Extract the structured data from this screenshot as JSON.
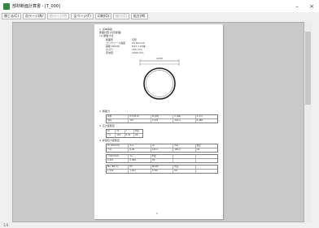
{
  "window": {
    "title": "部材断面計算書 - [T_000]",
    "minimize": "–",
    "close": "×"
  },
  "toolbar": [
    {
      "label": "閉じる(C)",
      "enabled": true
    },
    {
      "label": "次ページ(N)",
      "enabled": true
    },
    {
      "label": "前ページ(P)",
      "enabled": false
    },
    {
      "label": "全ページ(F)",
      "enabled": true
    },
    {
      "label": "印刷(O)",
      "enabled": true
    },
    {
      "label": "縮小(Z)",
      "enabled": false
    },
    {
      "label": "拡大(M)",
      "enabled": true
    }
  ],
  "page": {
    "heading": "1. 基本情報",
    "subheading": "断面計算 (円形断面)",
    "section1": "(1) 断面寸法",
    "params": [
      {
        "k": "断面形",
        "v": "円形"
      },
      {
        "k": "コンクリート強度",
        "v": "24 N/mm2"
      },
      {
        "k": "鉄筋 SD345",
        "v": "D22 x 20本"
      },
      {
        "k": "かぶり",
        "v": "100 mm"
      },
      {
        "k": "有効径",
        "v": "1000 mm"
      }
    ],
    "dim_label": "1200",
    "section2": "2. 断面力",
    "table2": [
      [
        "荷重",
        "M (kN.m)",
        "N (kN)",
        "S (kN)",
        "e (m)"
      ],
      [
        "常時",
        "567",
        "1,234",
        "123.4",
        "0.460"
      ]
    ],
    "section3": "3. 応力度照査",
    "table3": [
      [
        "σc",
        "σs",
        "τ",
        "判定"
      ],
      [
        "7.2",
        "143",
        "0.32",
        "OK"
      ]
    ],
    "section4": "4. 許容応力度照査",
    "table4a": [
      [
        "σc (N/mm2)",
        "σca",
        "σs",
        "σsa",
        "判定"
      ],
      [
        "7.21",
        "8.00",
        "143.2",
        "180.0",
        "OK"
      ]
    ],
    "table4b": [
      [
        "τ (N/mm2)",
        "τa",
        "判定",
        "",
        ""
      ],
      [
        "0.321",
        "0.390",
        "OK",
        "",
        ""
      ]
    ],
    "table4c": [
      [
        "Mu (kN.m)",
        "Mr",
        "Mu/Mr",
        "判定",
        ""
      ],
      [
        "1,234",
        "1,567",
        "0.787",
        "OK",
        ""
      ]
    ],
    "page_number": "1"
  },
  "status": {
    "text": "1/4"
  }
}
